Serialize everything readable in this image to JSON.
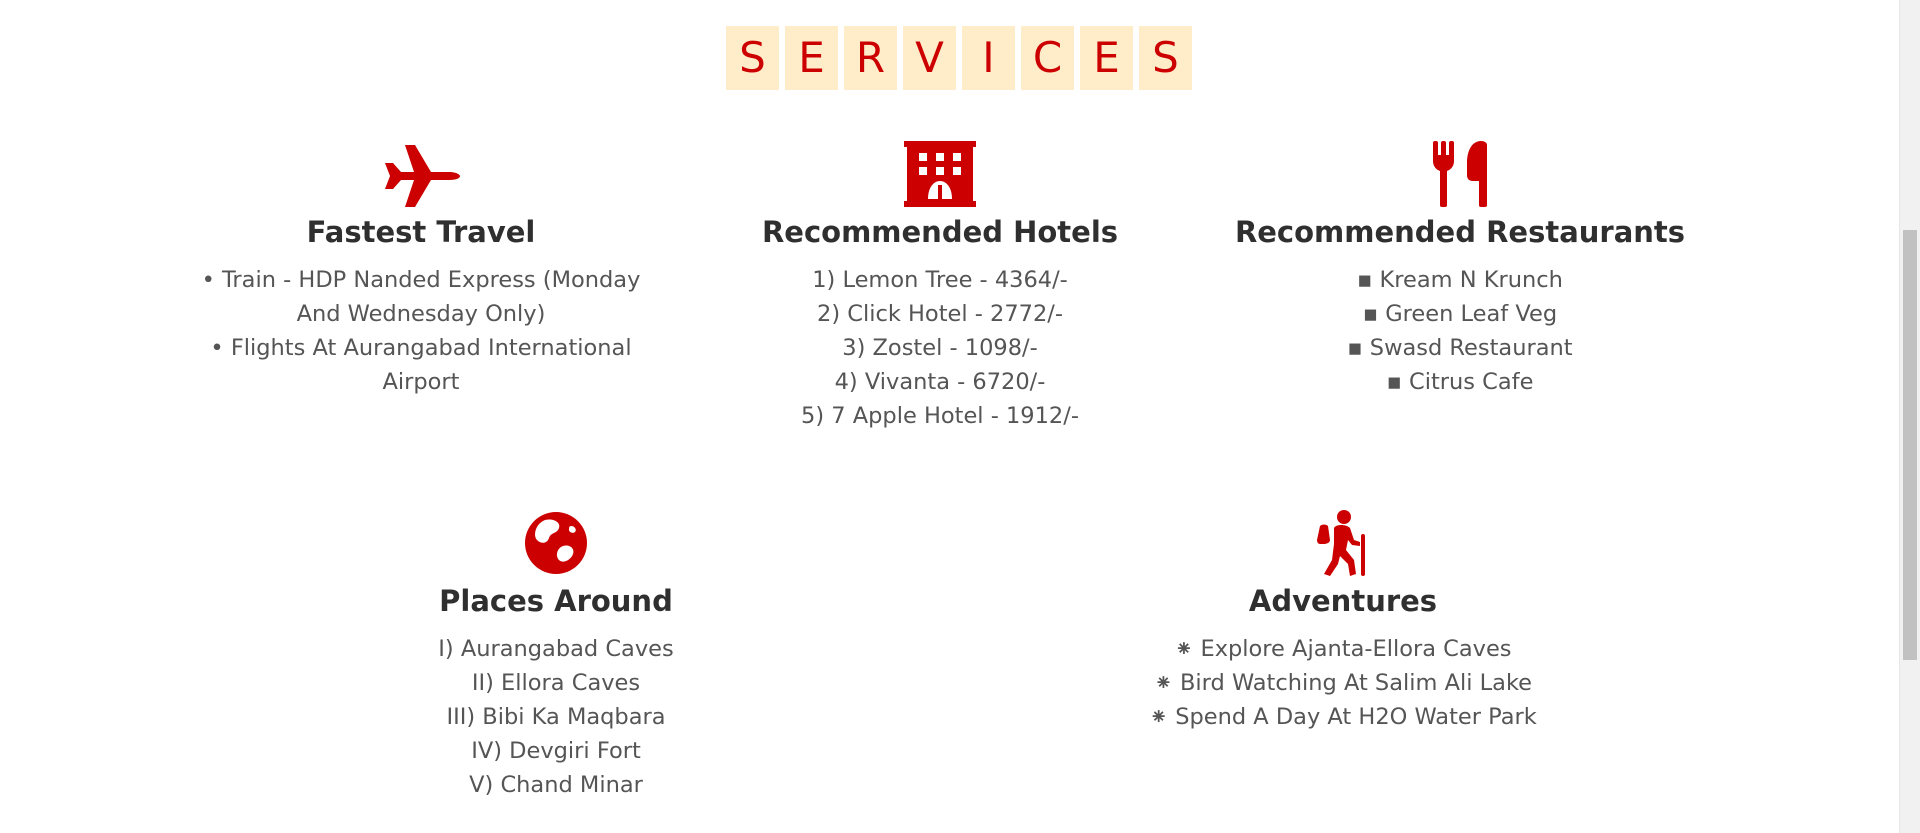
{
  "heading": {
    "letters": [
      "S",
      "E",
      "R",
      "V",
      "I",
      "C",
      "E",
      "S"
    ]
  },
  "colors": {
    "accent": "#cc0000",
    "letter_bg": "#ffecc9",
    "title": "#2f2f2f",
    "text": "#555555"
  },
  "services": {
    "travel": {
      "icon": "plane-icon",
      "title": "Fastest Travel",
      "items": [
        "• Train - HDP Nanded Express (Monday And Wednesday Only)",
        "• Flights At Aurangabad International Airport"
      ]
    },
    "hotels": {
      "icon": "hotel-icon",
      "title": "Recommended Hotels",
      "items": [
        "1) Lemon Tree - 4364/-",
        "2) Click Hotel - 2772/-",
        "3) Zostel - 1098/-",
        "4) Vivanta - 6720/-",
        "5) 7 Apple Hotel - 1912/-"
      ]
    },
    "restaurants": {
      "icon": "utensils-icon",
      "title": "Recommended Restaurants",
      "items": [
        "▪ Kream N Krunch",
        "▪ Green Leaf Veg",
        "▪ Swasd Restaurant",
        "▪ Citrus Cafe"
      ]
    },
    "places": {
      "icon": "globe-icon",
      "title": "Places Around",
      "items": [
        "I) Aurangabad Caves",
        "II) Ellora Caves",
        "III) Bibi Ka Maqbara",
        "IV) Devgiri Fort",
        "V) Chand Minar"
      ]
    },
    "adventures": {
      "icon": "hiking-icon",
      "title": "Adventures",
      "items": [
        "⁕ Explore Ajanta-Ellora Caves",
        "⁕ Bird Watching At Salim Ali Lake",
        "⁕ Spend A Day At H2O Water Park"
      ]
    }
  }
}
